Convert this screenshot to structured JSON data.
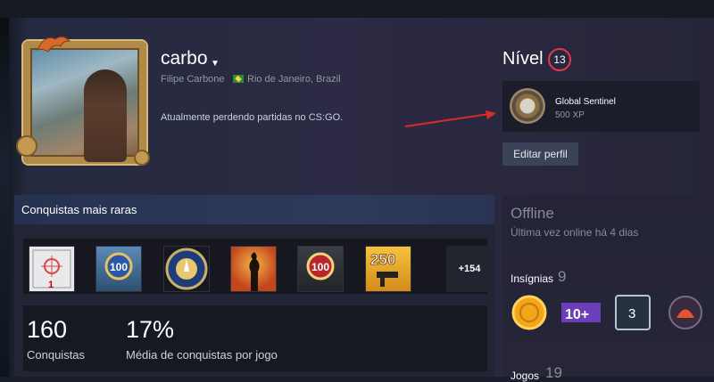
{
  "profile": {
    "username": "carbo",
    "real_name": "Filipe Carbone",
    "location": "Rio de Janeiro, Brazil",
    "summary": "Atualmente perdendo partidas no CS:GO."
  },
  "level": {
    "label": "Nível",
    "value": "13",
    "badge_name": "Global Sentinel",
    "badge_xp": "500 XP",
    "edit_button": "Editar perfil"
  },
  "achievements": {
    "title": "Conquistas mais raras",
    "items": [
      {
        "name": "achievement-cs-map-icon"
      },
      {
        "name": "achievement-100-ribbon-icon"
      },
      {
        "name": "achievement-blue-medal-icon"
      },
      {
        "name": "achievement-silhouette-icon"
      },
      {
        "name": "achievement-100-medal-icon"
      },
      {
        "name": "achievement-250-smg-icon"
      }
    ],
    "more": "+154",
    "total_value": "160",
    "total_label": "Conquistas",
    "avg_value": "17%",
    "avg_label": "Média de conquistas por jogo"
  },
  "sidebar": {
    "status": "Offline",
    "last_online": "Última vez online há 4 dias",
    "badges_label": "Insígnias",
    "badges_count": "9",
    "badge_icons": [
      {
        "name": "gold-coin-badge-icon"
      },
      {
        "name": "10-plus-badge-icon",
        "text": "10+"
      },
      {
        "name": "number-3-badge-icon",
        "text": "3"
      },
      {
        "name": "planet-badge-icon"
      }
    ],
    "games_label": "Jogos",
    "games_count": "19"
  },
  "colors": {
    "accent_red": "#e0394e",
    "section_header": "#2d3a5c",
    "button_bg": "#3b4358"
  }
}
